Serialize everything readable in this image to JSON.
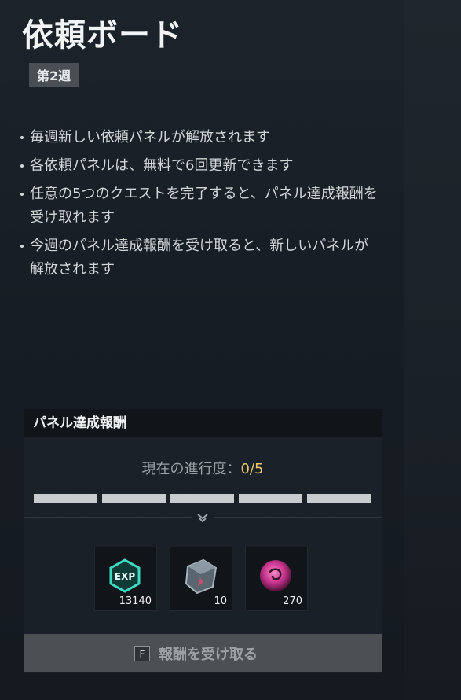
{
  "header": {
    "title": "依頼ボード",
    "week_badge": "第2週"
  },
  "rules": [
    "毎週新しい依頼パネルが解放されます",
    "各依頼パネルは、無料で6回更新できます",
    "任意の5つのクエストを完了すると、パネル達成報酬を受け取れます",
    "今週のパネル達成報酬を受け取ると、新しいパネルが解放されます"
  ],
  "panel": {
    "header": "パネル達成報酬",
    "progress_label": "現在の進行度：",
    "progress_value": "0/5",
    "progress_fraction": 0,
    "segments_total": 5,
    "rewards": [
      {
        "icon": "exp-icon",
        "quantity": "13140"
      },
      {
        "icon": "crystal-cube-icon",
        "quantity": "10"
      },
      {
        "icon": "purple-orb-icon",
        "quantity": "270"
      }
    ],
    "claim_key": "F",
    "claim_label": "報酬を受け取る"
  },
  "colors": {
    "progress_value": "#e8c86a",
    "exp_teal": "#3fd9c4",
    "orb_magenta": "#c8338e"
  }
}
